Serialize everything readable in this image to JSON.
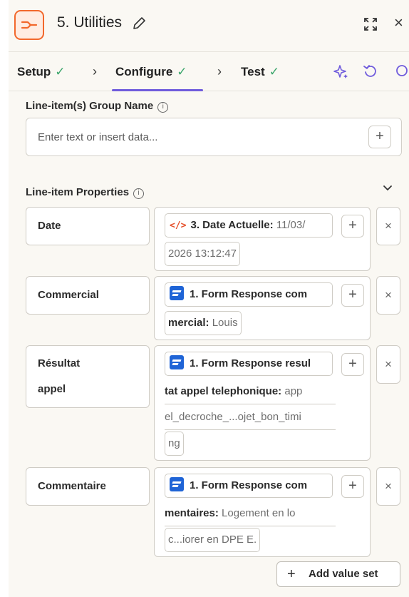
{
  "header": {
    "title": "5. Utilities"
  },
  "steps": {
    "setup": "Setup",
    "configure": "Configure",
    "test": "Test",
    "check": "✓",
    "chevron": "›"
  },
  "group_name": {
    "label": "Line-item(s) Group Name",
    "placeholder": "Enter text or insert data..."
  },
  "properties": {
    "label": "Line-item Properties",
    "rows": [
      {
        "key": "Date",
        "lines": [
          "3. Date Actuelle:",
          "11/03/",
          "2026 13:12:47"
        ]
      },
      {
        "key": "Commercial",
        "lines": [
          "1. Form Response com",
          "mercial:",
          "Louis"
        ]
      },
      {
        "key_line1": "Résultat",
        "key_line2": "appel",
        "lines": [
          "1. Form Response resul",
          "tat appel telephonique:",
          "app",
          "el_decroche_...ojet_bon_timi",
          "ng"
        ]
      },
      {
        "key": "Commentaire",
        "lines": [
          "1. Form Response com",
          "mentaires:",
          "Logement en lo",
          "c...iorer en DPE E."
        ]
      }
    ]
  },
  "add_value_set": "Add value set",
  "icons": {
    "plus": "+",
    "close": "×",
    "delete": "×"
  },
  "colors": {
    "brand_orange": "#f2682c",
    "accent_purple": "#6f5bdc",
    "check_green": "#3aa56b",
    "form_blue": "#1f64d6"
  }
}
